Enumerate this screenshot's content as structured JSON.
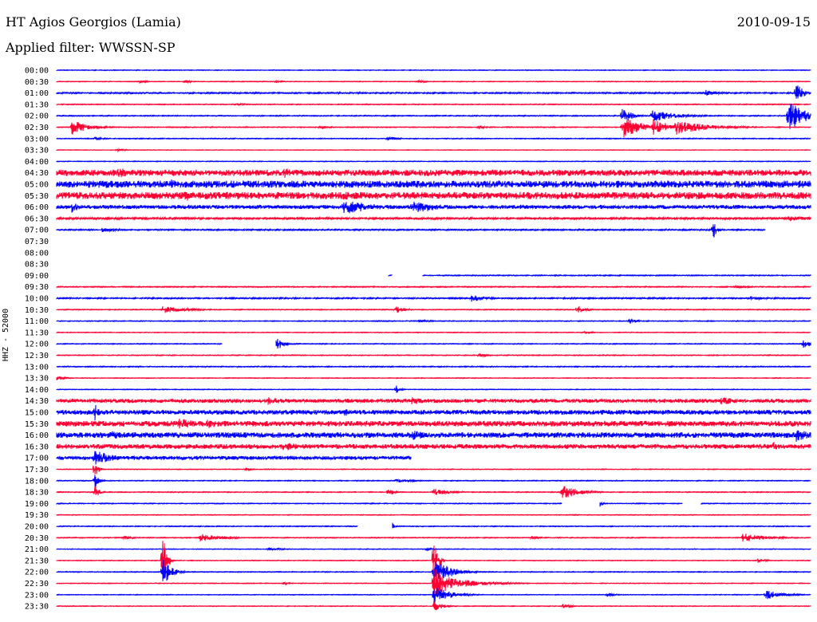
{
  "header": {
    "station": "HT Agios Georgios (Lamia)",
    "date": "2010-09-15",
    "filter": "Applied filter: WWSSN-SP",
    "channel_label": "HHZ - 52000"
  },
  "colors": {
    "even_trace": "#0000ff",
    "odd_trace": "#ff0033",
    "background": "#ffffff"
  },
  "chart_data": {
    "type": "line",
    "title": "HT Agios Georgios (Lamia)",
    "subtitle": "Applied filter: WWSSN-SP",
    "ylabel": "HHZ - 52000",
    "date": "2010-09-15",
    "rows": [
      {
        "time": "00:00",
        "noise": 0.4,
        "gaps": [],
        "events": []
      },
      {
        "time": "00:30",
        "noise": 0.4,
        "gaps": [],
        "events": [
          {
            "t": 0.11,
            "amp": 2,
            "dur": 0.01
          },
          {
            "t": 0.17,
            "amp": 2,
            "dur": 0.01
          },
          {
            "t": 0.29,
            "amp": 2,
            "dur": 0.01
          },
          {
            "t": 0.48,
            "amp": 2,
            "dur": 0.01
          }
        ]
      },
      {
        "time": "01:00",
        "noise": 0.8,
        "gaps": [],
        "events": [
          {
            "t": 0.86,
            "amp": 4,
            "dur": 0.02
          },
          {
            "t": 0.98,
            "amp": 14,
            "dur": 0.01
          }
        ]
      },
      {
        "time": "01:30",
        "noise": 0.5,
        "gaps": [],
        "events": [
          {
            "t": 0.24,
            "amp": 2,
            "dur": 0.01
          }
        ]
      },
      {
        "time": "02:00",
        "noise": 0.6,
        "gaps": [],
        "events": [
          {
            "t": 0.75,
            "amp": 14,
            "dur": 0.01
          },
          {
            "t": 0.79,
            "amp": 8,
            "dur": 0.03
          },
          {
            "t": 0.97,
            "amp": 22,
            "dur": 0.02
          }
        ]
      },
      {
        "time": "02:30",
        "noise": 0.5,
        "gaps": [],
        "events": [
          {
            "t": 0.02,
            "amp": 10,
            "dur": 0.02
          },
          {
            "t": 0.35,
            "amp": 3,
            "dur": 0.01
          },
          {
            "t": 0.56,
            "amp": 3,
            "dur": 0.01
          },
          {
            "t": 0.75,
            "amp": 14,
            "dur": 0.03
          },
          {
            "t": 0.79,
            "amp": 12,
            "dur": 0.02
          },
          {
            "t": 0.82,
            "amp": 10,
            "dur": 0.04
          }
        ]
      },
      {
        "time": "03:00",
        "noise": 0.5,
        "gaps": [],
        "events": [
          {
            "t": 0.05,
            "amp": 3,
            "dur": 0.01
          },
          {
            "t": 0.44,
            "amp": 4,
            "dur": 0.01
          }
        ]
      },
      {
        "time": "03:30",
        "noise": 0.3,
        "gaps": [],
        "events": [
          {
            "t": 0.08,
            "amp": 2,
            "dur": 0.01
          }
        ]
      },
      {
        "time": "04:00",
        "noise": 0.4,
        "gaps": [],
        "events": []
      },
      {
        "time": "04:30",
        "noise": 4,
        "gaps": [],
        "events": [
          {
            "t": 0.08,
            "amp": 7,
            "dur": 0.03
          },
          {
            "t": 0.3,
            "amp": 7,
            "dur": 0.03
          }
        ]
      },
      {
        "time": "05:00",
        "noise": 4.5,
        "gaps": [],
        "events": [
          {
            "t": 0.15,
            "amp": 7,
            "dur": 0.02
          }
        ]
      },
      {
        "time": "05:30",
        "noise": 4.5,
        "gaps": [],
        "events": [
          {
            "t": 0.17,
            "amp": 8,
            "dur": 0.02
          },
          {
            "t": 0.38,
            "amp": 7,
            "dur": 0.02
          }
        ]
      },
      {
        "time": "06:00",
        "noise": 2.5,
        "gaps": [],
        "events": [
          {
            "t": 0.02,
            "amp": 8,
            "dur": 0.01
          },
          {
            "t": 0.38,
            "amp": 10,
            "dur": 0.04
          },
          {
            "t": 0.47,
            "amp": 9,
            "dur": 0.04
          }
        ]
      },
      {
        "time": "06:30",
        "noise": 1.2,
        "gaps": [],
        "events": [
          {
            "t": 0.97,
            "amp": 4,
            "dur": 0.03
          }
        ]
      },
      {
        "time": "07:00",
        "noise": 0.8,
        "gaps": [
          [
            0.94,
            1.0
          ]
        ],
        "events": [
          {
            "t": 0.06,
            "amp": 3,
            "dur": 0.02
          },
          {
            "t": 0.87,
            "amp": 14,
            "dur": 0.005
          }
        ]
      },
      {
        "time": "07:30",
        "noise": 0,
        "gaps": [
          [
            0.0,
            1.0
          ]
        ],
        "events": []
      },
      {
        "time": "08:00",
        "noise": 0,
        "gaps": [
          [
            0.0,
            1.0
          ]
        ],
        "events": []
      },
      {
        "time": "08:30",
        "noise": 0,
        "gaps": [
          [
            0.0,
            1.0
          ]
        ],
        "events": []
      },
      {
        "time": "09:00",
        "noise": 0.6,
        "gaps": [
          [
            0.0,
            0.44
          ],
          [
            0.445,
            0.485
          ]
        ],
        "events": []
      },
      {
        "time": "09:30",
        "noise": 0.6,
        "gaps": [],
        "events": [
          {
            "t": 0.9,
            "amp": 2,
            "dur": 0.02
          }
        ]
      },
      {
        "time": "10:00",
        "noise": 0.8,
        "gaps": [],
        "events": [
          {
            "t": 0.55,
            "amp": 5,
            "dur": 0.02
          },
          {
            "t": 0.92,
            "amp": 3,
            "dur": 0.02
          }
        ]
      },
      {
        "time": "10:30",
        "noise": 0.5,
        "gaps": [],
        "events": [
          {
            "t": 0.14,
            "amp": 5,
            "dur": 0.03
          },
          {
            "t": 0.45,
            "amp": 6,
            "dur": 0.01
          },
          {
            "t": 0.69,
            "amp": 6,
            "dur": 0.01
          }
        ]
      },
      {
        "time": "11:00",
        "noise": 0.5,
        "gaps": [],
        "events": [
          {
            "t": 0.48,
            "amp": 2,
            "dur": 0.02
          },
          {
            "t": 0.76,
            "amp": 4,
            "dur": 0.01
          }
        ]
      },
      {
        "time": "11:30",
        "noise": 0.4,
        "gaps": [],
        "events": [
          {
            "t": 0.7,
            "amp": 2,
            "dur": 0.01
          }
        ]
      },
      {
        "time": "12:00",
        "noise": 0.5,
        "gaps": [
          [
            0.22,
            0.29
          ]
        ],
        "events": [
          {
            "t": 0.29,
            "amp": 10,
            "dur": 0.01
          },
          {
            "t": 0.99,
            "amp": 6,
            "dur": 0.01
          }
        ]
      },
      {
        "time": "12:30",
        "noise": 0.5,
        "gaps": [],
        "events": [
          {
            "t": 0.56,
            "amp": 3,
            "dur": 0.01
          }
        ]
      },
      {
        "time": "13:00",
        "noise": 0.6,
        "gaps": [],
        "events": []
      },
      {
        "time": "13:30",
        "noise": 0.4,
        "gaps": [],
        "events": [
          {
            "t": 0.0,
            "amp": 3,
            "dur": 0.01
          }
        ]
      },
      {
        "time": "14:00",
        "noise": 0.4,
        "gaps": [],
        "events": [
          {
            "t": 0.45,
            "amp": 6,
            "dur": 0.005
          }
        ]
      },
      {
        "time": "14:30",
        "noise": 2.5,
        "gaps": [],
        "events": [
          {
            "t": 0.28,
            "amp": 5,
            "dur": 0.03
          },
          {
            "t": 0.47,
            "amp": 5,
            "dur": 0.03
          },
          {
            "t": 0.88,
            "amp": 5,
            "dur": 0.04
          }
        ]
      },
      {
        "time": "15:00",
        "noise": 3,
        "gaps": [],
        "events": [
          {
            "t": 0.05,
            "amp": 14,
            "dur": 0.005
          },
          {
            "t": 0.38,
            "amp": 6,
            "dur": 0.02
          }
        ]
      },
      {
        "time": "15:30",
        "noise": 3.5,
        "gaps": [],
        "events": [
          {
            "t": 0.16,
            "amp": 8,
            "dur": 0.03
          },
          {
            "t": 0.2,
            "amp": 7,
            "dur": 0.02
          }
        ]
      },
      {
        "time": "16:00",
        "noise": 3.5,
        "gaps": [],
        "events": [
          {
            "t": 0.07,
            "amp": 6,
            "dur": 0.03
          },
          {
            "t": 0.47,
            "amp": 7,
            "dur": 0.03
          },
          {
            "t": 0.98,
            "amp": 9,
            "dur": 0.02
          }
        ]
      },
      {
        "time": "16:30",
        "noise": 3,
        "gaps": [],
        "events": [
          {
            "t": 0.3,
            "amp": 6,
            "dur": 0.03
          },
          {
            "t": 0.95,
            "amp": 6,
            "dur": 0.02
          }
        ]
      },
      {
        "time": "17:00",
        "noise": 2.5,
        "gaps": [
          [
            0.47,
            1.0
          ]
        ],
        "events": [
          {
            "t": 0.05,
            "amp": 13,
            "dur": 0.02
          }
        ]
      },
      {
        "time": "17:30",
        "noise": 0.4,
        "gaps": [],
        "events": [
          {
            "t": 0.05,
            "amp": 12,
            "dur": 0.005
          },
          {
            "t": 0.25,
            "amp": 2,
            "dur": 0.01
          }
        ]
      },
      {
        "time": "18:00",
        "noise": 0.5,
        "gaps": [],
        "events": [
          {
            "t": 0.05,
            "amp": 12,
            "dur": 0.005
          },
          {
            "t": 0.45,
            "amp": 3,
            "dur": 0.02
          }
        ]
      },
      {
        "time": "18:30",
        "noise": 0.5,
        "gaps": [],
        "events": [
          {
            "t": 0.05,
            "amp": 12,
            "dur": 0.005
          },
          {
            "t": 0.44,
            "amp": 8,
            "dur": 0.005
          },
          {
            "t": 0.5,
            "amp": 5,
            "dur": 0.02
          },
          {
            "t": 0.67,
            "amp": 10,
            "dur": 0.02
          }
        ]
      },
      {
        "time": "19:00",
        "noise": 0.5,
        "gaps": [
          [
            0.67,
            0.72
          ],
          [
            0.83,
            0.855
          ]
        ],
        "events": [
          {
            "t": 0.72,
            "amp": 5,
            "dur": 0.003
          }
        ]
      },
      {
        "time": "19:30",
        "noise": 0.4,
        "gaps": [],
        "events": []
      },
      {
        "time": "20:00",
        "noise": 0.5,
        "gaps": [
          [
            0.4,
            0.445
          ]
        ],
        "events": [
          {
            "t": 0.445,
            "amp": 7,
            "dur": 0.003
          }
        ]
      },
      {
        "time": "20:30",
        "noise": 0.5,
        "gaps": [],
        "events": [
          {
            "t": 0.09,
            "amp": 3,
            "dur": 0.01
          },
          {
            "t": 0.19,
            "amp": 5,
            "dur": 0.03
          },
          {
            "t": 0.63,
            "amp": 3,
            "dur": 0.01
          },
          {
            "t": 0.91,
            "amp": 6,
            "dur": 0.03
          }
        ]
      },
      {
        "time": "21:00",
        "noise": 0.4,
        "gaps": [],
        "events": [
          {
            "t": 0.28,
            "amp": 2,
            "dur": 0.02
          },
          {
            "t": 0.49,
            "amp": 2,
            "dur": 0.01
          }
        ]
      },
      {
        "time": "21:30",
        "noise": 0.4,
        "gaps": [],
        "events": [
          {
            "t": 0.14,
            "amp": 42,
            "dur": 0.005
          },
          {
            "t": 0.5,
            "amp": 40,
            "dur": 0.005
          },
          {
            "t": 0.93,
            "amp": 3,
            "dur": 0.01
          }
        ]
      },
      {
        "time": "22:00",
        "noise": 0.5,
        "gaps": [],
        "events": [
          {
            "t": 0.14,
            "amp": 22,
            "dur": 0.01
          },
          {
            "t": 0.5,
            "amp": 18,
            "dur": 0.02
          }
        ]
      },
      {
        "time": "22:30",
        "noise": 0.4,
        "gaps": [],
        "events": [
          {
            "t": 0.3,
            "amp": 2,
            "dur": 0.01
          },
          {
            "t": 0.5,
            "amp": 22,
            "dur": 0.02
          },
          {
            "t": 0.52,
            "amp": 8,
            "dur": 0.04
          }
        ]
      },
      {
        "time": "23:00",
        "noise": 0.4,
        "gaps": [],
        "events": [
          {
            "t": 0.5,
            "amp": 12,
            "dur": 0.02
          },
          {
            "t": 0.73,
            "amp": 3,
            "dur": 0.01
          },
          {
            "t": 0.94,
            "amp": 7,
            "dur": 0.02
          }
        ]
      },
      {
        "time": "23:30",
        "noise": 0.4,
        "gaps": [],
        "events": [
          {
            "t": 0.5,
            "amp": 8,
            "dur": 0.01
          },
          {
            "t": 0.67,
            "amp": 4,
            "dur": 0.01
          }
        ]
      }
    ]
  }
}
